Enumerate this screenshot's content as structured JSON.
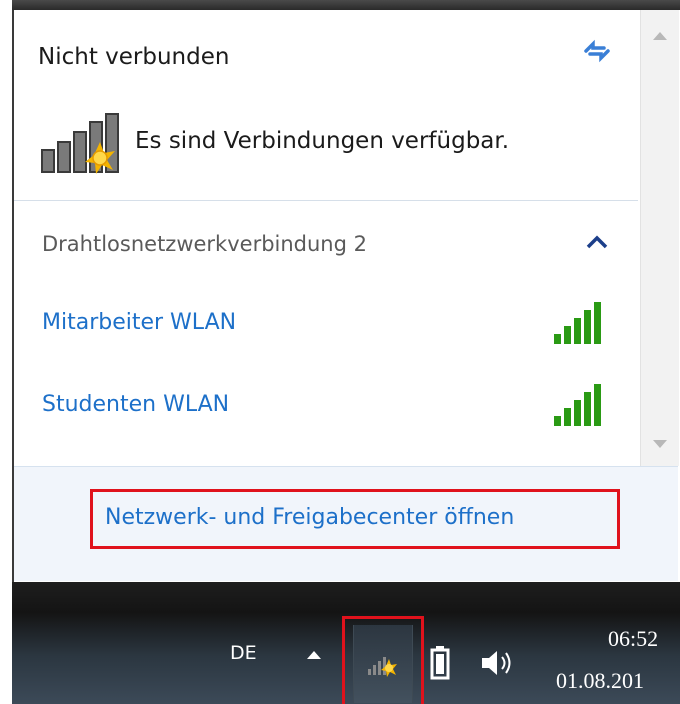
{
  "flyout": {
    "status_title": "Nicht verbunden",
    "status_text": "Es sind Verbindungen verfügbar.",
    "connection_name": "Drahtlosnetzwerkverbindung 2",
    "networks": [
      {
        "name": "Mitarbeiter WLAN",
        "signal_bars": 5
      },
      {
        "name": "Studenten WLAN",
        "signal_bars": 5
      }
    ],
    "footer_link": "Netzwerk- und Freigabecenter öffnen",
    "icons": {
      "refresh": "refresh-arrows-icon",
      "status": "network-signal-sun-icon",
      "collapse": "chevron-up-icon",
      "signal": "wifi-signal-bars-icon"
    }
  },
  "taskbar": {
    "language": "DE",
    "time": "06:52",
    "date": "01.08.201",
    "icons": [
      "tray-arrow-icon",
      "network-status-icon",
      "battery-icon",
      "speaker-icon"
    ]
  },
  "colors": {
    "link": "#1d70c9",
    "highlight_box": "#e0121c",
    "signal_green": "#2a9a14",
    "refresh_blue": "#3a7fd6"
  }
}
